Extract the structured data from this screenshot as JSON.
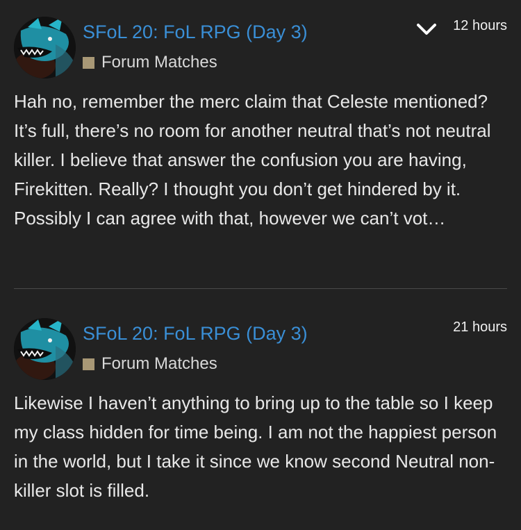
{
  "colors": {
    "background": "#222222",
    "title_link": "#3a8fd6",
    "category_swatch": "#a89876",
    "text": "#e8e8e8",
    "divider": "#4a4a4a"
  },
  "posts": [
    {
      "title": "SFoL 20: FoL RPG (Day 3)",
      "category": "Forum Matches",
      "time": "12 hours",
      "has_expand": true,
      "expand_icon": "chevron-down-icon",
      "avatar_icon": "dragon-avatar",
      "body": "Hah no, remember the merc claim that Celeste mentioned? It’s full, there’s no room for another neutral that’s not neutral killer. I believe that answer the confusion you are having, Firekitten. Really? I thought you don’t get hindered by it. Possibly I can agree with that, however we can’t vot…"
    },
    {
      "title": "SFoL 20: FoL RPG (Day 3)",
      "category": "Forum Matches",
      "time": "21 hours",
      "has_expand": false,
      "avatar_icon": "dragon-avatar",
      "body": "Likewise I haven’t anything to bring up to the table so I keep my class hidden for time being. I am not the happiest person in the world, but I take it since we know second Neutral non-killer slot is filled."
    }
  ]
}
